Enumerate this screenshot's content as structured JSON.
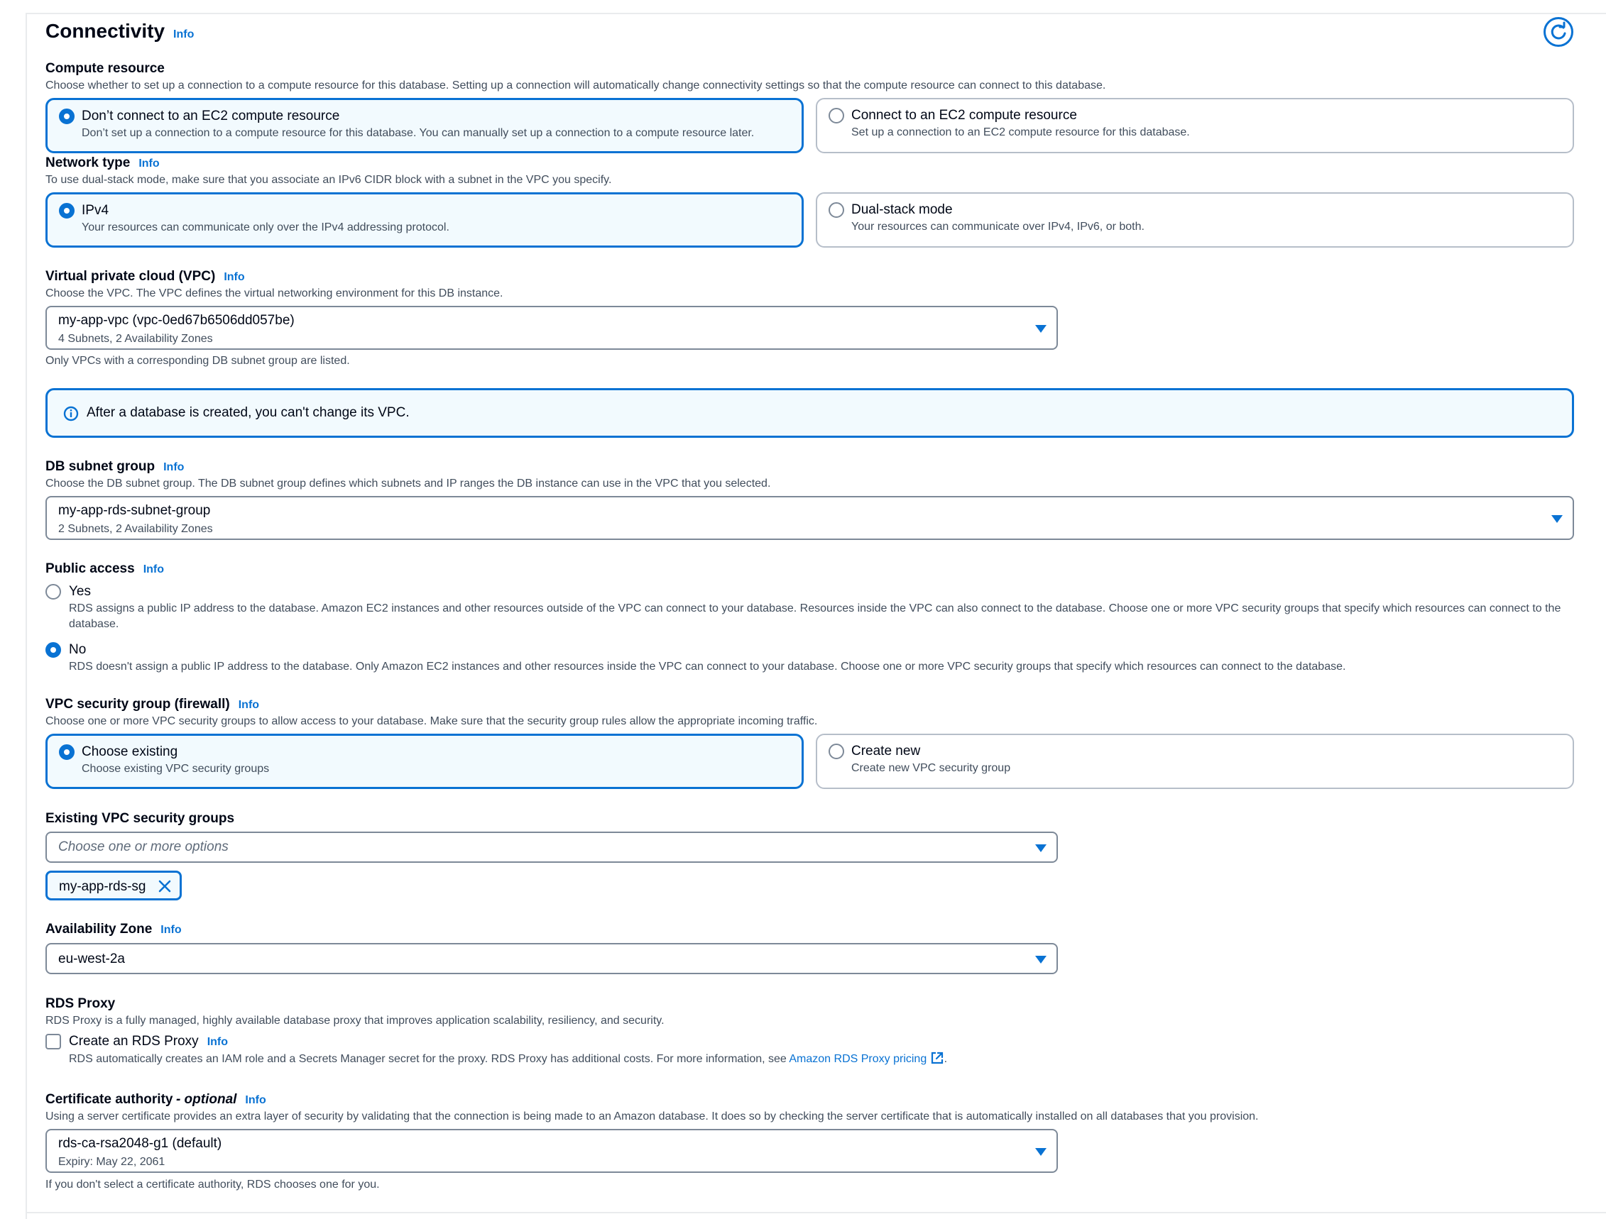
{
  "section": {
    "title": "Connectivity",
    "info": "Info"
  },
  "compute": {
    "label": "Compute resource",
    "description": "Choose whether to set up a connection to a compute resource for this database. Setting up a connection will automatically change connectivity settings so that the compute resource can connect to this database.",
    "options": [
      {
        "title": "Don’t connect to an EC2 compute resource",
        "desc": "Don’t set up a connection to a compute resource for this database. You can manually set up a connection to a compute resource later.",
        "selected": true
      },
      {
        "title": "Connect to an EC2 compute resource",
        "desc": "Set up a connection to an EC2 compute resource for this database.",
        "selected": false
      }
    ]
  },
  "network": {
    "label": "Network type",
    "info": "Info",
    "description": "To use dual-stack mode, make sure that you associate an IPv6 CIDR block with a subnet in the VPC you specify.",
    "options": [
      {
        "title": "IPv4",
        "desc": "Your resources can communicate only over the IPv4 addressing protocol.",
        "selected": true
      },
      {
        "title": "Dual-stack mode",
        "desc": "Your resources can communicate over IPv4, IPv6, or both.",
        "selected": false
      }
    ]
  },
  "vpc": {
    "label": "Virtual private cloud (VPC)",
    "info": "Info",
    "description": "Choose the VPC. The VPC defines the virtual networking environment for this DB instance.",
    "value": "my-app-vpc (vpc-0ed67b6506dd057be)",
    "sub": "4 Subnets, 2 Availability Zones",
    "hint": "Only VPCs with a corresponding DB subnet group are listed.",
    "alert": "After a database is created, you can't change its VPC."
  },
  "subnet": {
    "label": "DB subnet group",
    "info": "Info",
    "description": "Choose the DB subnet group. The DB subnet group defines which subnets and IP ranges the DB instance can use in the VPC that you selected.",
    "value": "my-app-rds-subnet-group",
    "sub": "2 Subnets, 2 Availability Zones"
  },
  "public_access": {
    "label": "Public access",
    "info": "Info",
    "options": [
      {
        "title": "Yes",
        "desc": "RDS assigns a public IP address to the database. Amazon EC2 instances and other resources outside of the VPC can connect to your database. Resources inside the VPC can also connect to the database. Choose one or more VPC security groups that specify which resources can connect to the database.",
        "selected": false
      },
      {
        "title": "No",
        "desc": "RDS doesn't assign a public IP address to the database. Only Amazon EC2 instances and other resources inside the VPC can connect to your database. Choose one or more VPC security groups that specify which resources can connect to the database.",
        "selected": true
      }
    ]
  },
  "security_group": {
    "label": "VPC security group (firewall)",
    "info": "Info",
    "description": "Choose one or more VPC security groups to allow access to your database. Make sure that the security group rules allow the appropriate incoming traffic.",
    "options": [
      {
        "title": "Choose existing",
        "desc": "Choose existing VPC security groups",
        "selected": true
      },
      {
        "title": "Create new",
        "desc": "Create new VPC security group",
        "selected": false
      }
    ]
  },
  "existing_groups": {
    "label": "Existing VPC security groups",
    "placeholder": "Choose one or more options",
    "tokens": [
      "my-app-rds-sg"
    ]
  },
  "az": {
    "label": "Availability Zone",
    "info": "Info",
    "value": "eu-west-2a"
  },
  "proxy": {
    "label": "RDS Proxy",
    "description": "RDS Proxy is a fully managed, highly available database proxy that improves application scalability, resiliency, and security.",
    "checkbox_label": "Create an RDS Proxy",
    "info": "Info",
    "checked": false,
    "detail": "RDS automatically creates an IAM role and a Secrets Manager secret for the proxy. RDS Proxy has additional costs. For more information, see",
    "link": "Amazon RDS Proxy pricing",
    "after_link": "."
  },
  "ca": {
    "label": "Certificate authority",
    "label_suffix": "- optional",
    "info": "Info",
    "description": "Using a server certificate provides an extra layer of security by validating that the connection is being made to an Amazon database. It does so by checking the server certificate that is automatically installed on all databases that you provision.",
    "value": "rds-ca-rsa2048-g1 (default)",
    "sub": "Expiry: May 22, 2061",
    "hint": "If you don't select a certificate authority, RDS chooses one for you."
  },
  "colors": {
    "accent": "#0972d3",
    "selected_bg": "#f2fafe",
    "border": "#7d8998",
    "text": "#000716",
    "muted": "#414d5c"
  }
}
